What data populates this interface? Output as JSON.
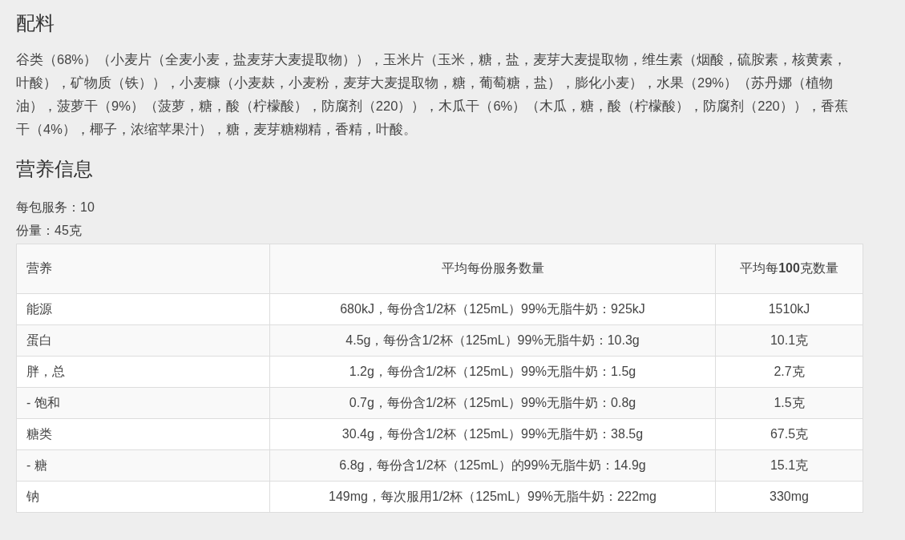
{
  "ingredients": {
    "heading": "配料",
    "text": "谷类（68%）（小麦片（全麦小麦，盐麦芽大麦提取物）），玉米片（玉米，糖，盐，麦芽大麦提取物，维生素（烟酸，硫胺素，核黄素，叶酸），矿物质（铁）），小麦糠（小麦麸，小麦粉，麦芽大麦提取物，糖，葡萄糖，盐），膨化小麦），水果（29%）（苏丹娜（植物油），菠萝干（9%）（菠萝，糖，酸（柠檬酸），防腐剂（220）），木瓜干（6%）（木瓜，糖，酸（柠檬酸），防腐剂（220）），香蕉干（4%），椰子，浓缩苹果汁），糖，麦芽糖糊精，香精，叶酸。"
  },
  "nutrition": {
    "heading": "营养信息",
    "facts": [
      "每包服务：10",
      "份量：45克"
    ],
    "table": {
      "columns": [
        "营养",
        "平均每份服务数量",
        "平均每**100**克数量"
      ],
      "rows": [
        [
          "能源",
          "680kJ，每份含1/2杯（125mL）99%无脂牛奶：925kJ",
          "1510kJ"
        ],
        [
          "蛋白",
          "4.5g，每份含1/2杯（125mL）99%无脂牛奶：10.3g",
          "10.1克"
        ],
        [
          "胖，总",
          "1.2g，每份含1/2杯（125mL）99%无脂牛奶：1.5g",
          "2.7克"
        ],
        [
          "- 饱和",
          "0.7g，每份含1/2杯（125mL）99%无脂牛奶：0.8g",
          "1.5克"
        ],
        [
          "糖类",
          "30.4g，每份含1/2杯（125mL）99%无脂牛奶：38.5g",
          "67.5克"
        ],
        [
          "- 糖",
          "6.8g，每份含1/2杯（125mL）的99%无脂牛奶：14.9g",
          "15.1克"
        ],
        [
          "钠",
          "149mg，每次服用1/2杯（125mL）99%无脂牛奶：222mg",
          "330mg"
        ]
      ]
    }
  }
}
